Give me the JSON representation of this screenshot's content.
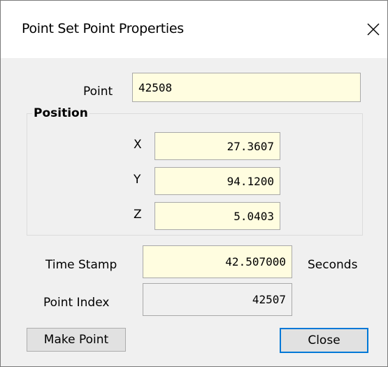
{
  "window": {
    "title": "Point Set Point Properties",
    "close_glyph": "✕"
  },
  "point": {
    "label": "Point",
    "value": "42508"
  },
  "position": {
    "group_label": "Position",
    "x_label": "X",
    "x_value": "27.3607",
    "y_label": "Y",
    "y_value": "94.1200",
    "z_label": "Z",
    "z_value": "5.0403"
  },
  "time_stamp": {
    "label": "Time Stamp",
    "value": "42.507000",
    "unit": "Seconds"
  },
  "point_index": {
    "label": "Point Index",
    "value": "42507"
  },
  "buttons": {
    "make_point": "Make Point",
    "close": "Close"
  },
  "colors": {
    "field_background": "#fffde0",
    "default_button_border": "#0078d7",
    "dialog_background": "#f0f0f0"
  }
}
